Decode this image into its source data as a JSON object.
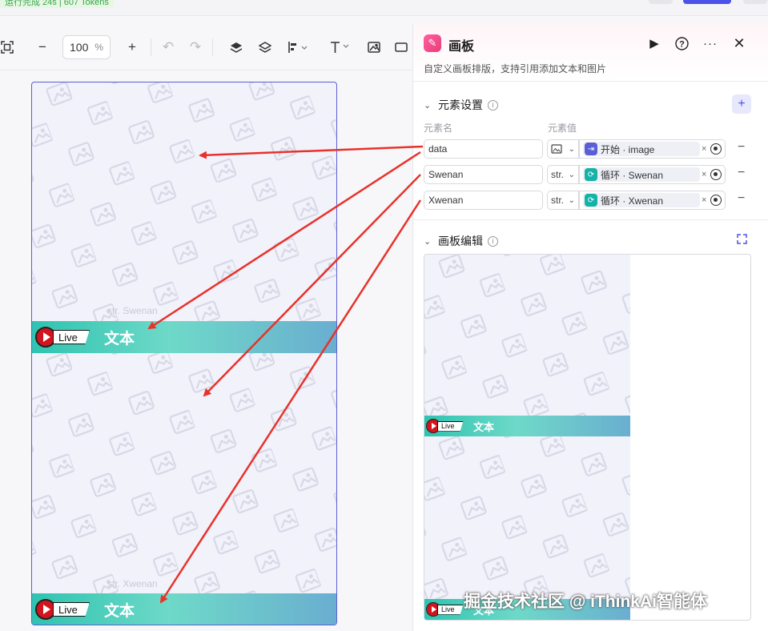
{
  "top": {
    "run_status": "运行完成 24s | 607 Tokens"
  },
  "toolbar": {
    "zoom_value": "100",
    "zoom_unit": "%"
  },
  "canvas": {
    "placeholder_1": "str. Swenan",
    "placeholder_2": "str. Xwenan",
    "banner_text": "文本",
    "live_label": "Live"
  },
  "panel": {
    "title": "画板",
    "description": "自定义画板排版，支持引用添加文本和图片",
    "elements_section": "元素设置",
    "col_name": "元素名",
    "col_value": "元素值",
    "elements": [
      {
        "name": "data",
        "type": "",
        "ref_source": "开始",
        "ref_var": "image",
        "ref_text": "开始 · image",
        "ref_color": "#5b5fd6"
      },
      {
        "name": "Swenan",
        "type": "str.",
        "ref_source": "循环",
        "ref_var": "Swenan",
        "ref_text": "循环 · Swenan",
        "ref_color": "#14b3a8"
      },
      {
        "name": "Xwenan",
        "type": "str.",
        "ref_source": "循环",
        "ref_var": "Xwenan",
        "ref_text": "循环 · Xwenan",
        "ref_color": "#14b3a8"
      }
    ],
    "editor_section": "画板编辑"
  },
  "preview": {
    "banner_text": "文本",
    "live_label": "Live"
  },
  "watermark": "掘金技术社区 @ iThinkAi智能体",
  "colors": {
    "accent": "#4d53e8",
    "arrow": "#e8322a",
    "banner_start": "#2fc3b0",
    "banner_end": "#6aaed0"
  }
}
